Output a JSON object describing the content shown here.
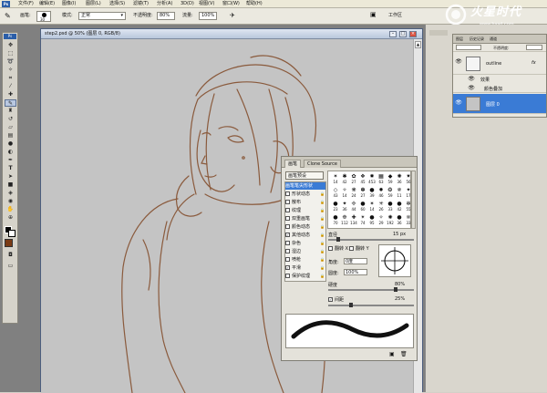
{
  "menubar": {
    "logo": "Ps",
    "items": [
      "文件(F)",
      "编辑(E)",
      "图像(I)",
      "图层(L)",
      "选择(S)",
      "滤镜(T)",
      "分析(A)",
      "3D(D)",
      "视图(V)",
      "窗口(W)",
      "帮助(H)"
    ]
  },
  "optbar": {
    "brush_label": "画笔:",
    "brush_size": "30",
    "mode_label": "模式:",
    "mode_value": "正常",
    "opacity_label": "不透明度:",
    "opacity_value": "80%",
    "flow_label": "流量:",
    "flow_value": "100%",
    "workspace_label": "工作区"
  },
  "watermark": {
    "brand": "火星时代",
    "url": "www.hxsd.com"
  },
  "document": {
    "title": "step2.psd @ 50% (图层 0, RGB/8)"
  },
  "brushes_panel": {
    "tabs": [
      "画笔",
      "Clone Source"
    ],
    "presets_button": "画笔预设",
    "options": [
      {
        "label": "画笔笔尖形状",
        "checked": false,
        "selected": true
      },
      {
        "label": "形状动态",
        "checked": false
      },
      {
        "label": "散布",
        "checked": false
      },
      {
        "label": "纹理",
        "checked": false
      },
      {
        "label": "双重画笔",
        "checked": false
      },
      {
        "label": "颜色动态",
        "checked": false
      },
      {
        "label": "其他动态",
        "checked": true
      },
      {
        "label": "杂色",
        "checked": false
      },
      {
        "label": "湿边",
        "checked": false
      },
      {
        "label": "喷枪",
        "checked": false
      },
      {
        "label": "平滑",
        "checked": true
      },
      {
        "label": "保护纹理",
        "checked": false
      }
    ],
    "tip_sizes": [
      "14",
      "42",
      "27",
      "45",
      "453",
      "63",
      "59",
      "36",
      "56",
      "43",
      "14",
      "24",
      "27",
      "39",
      "46",
      "59",
      "11",
      "17",
      "23",
      "36",
      "44",
      "60",
      "14",
      "26",
      "33",
      "42",
      "55",
      "70",
      "112",
      "134",
      "74",
      "95",
      "29",
      "192",
      "36",
      "33"
    ],
    "diameter_label": "直径",
    "diameter_value": "15 px",
    "flip_x": "翻转 X",
    "flip_y": "翻转 Y",
    "angle_label": "角度:",
    "angle_value": "0度",
    "roundness_label": "圆度:",
    "roundness_value": "100%",
    "hardness_label": "硬度",
    "hardness_value": "80%",
    "spacing_label": "间距",
    "spacing_value": "25%",
    "spacing_checked": true
  },
  "panels": {
    "tabs": [
      "图层",
      "历史记录",
      "通道"
    ],
    "opacity_label": "不透明度:",
    "layers": [
      {
        "name": "outline",
        "fx": "fx"
      },
      {
        "name": "效果",
        "sub": true
      },
      {
        "name": "颜色叠加",
        "sub": true
      },
      {
        "name": "图层 0",
        "selected": true
      }
    ]
  },
  "colors": {
    "accent": "#3a7bd5",
    "line": "#8a5a3c"
  }
}
